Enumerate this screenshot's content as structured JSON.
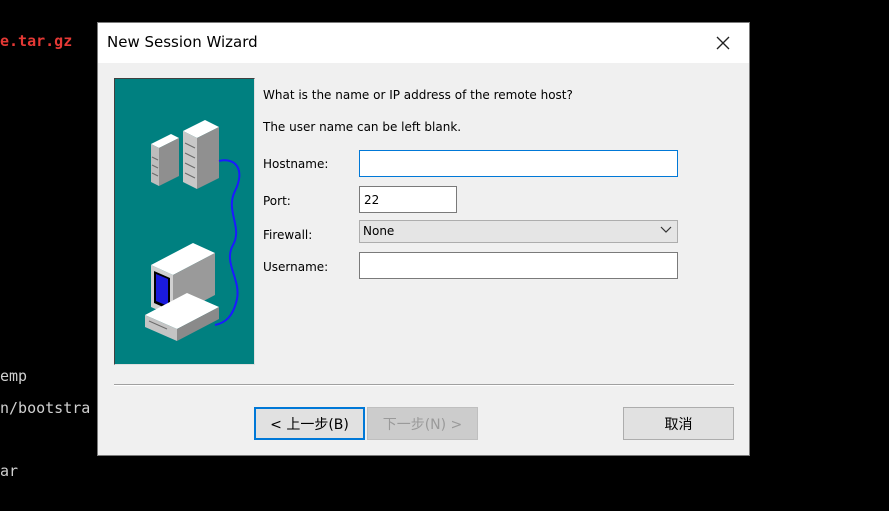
{
  "terminal": {
    "lines": [
      {
        "text": "e.tar.gz",
        "color": "#e53935"
      },
      {
        "text": "emp"
      },
      {
        "text": "n/bootstra"
      },
      {
        "text": "ar"
      }
    ]
  },
  "dialog": {
    "title": "New Session Wizard",
    "close_icon": "close-icon",
    "prompt_question": "What is the name or IP address of the remote host?",
    "prompt_note": "The user name can be left blank.",
    "fields": {
      "hostname": {
        "label": "Hostname:",
        "value": ""
      },
      "port": {
        "label": "Port:",
        "value": "22"
      },
      "firewall": {
        "label": "Firewall:",
        "selected": "None"
      },
      "username": {
        "label": "Username:",
        "value": ""
      }
    },
    "buttons": {
      "back": "< 上一步(B)",
      "next": "下一步(N) >",
      "cancel": "取消"
    },
    "illustration_bg": "#008080",
    "accent": "#0078d7"
  }
}
